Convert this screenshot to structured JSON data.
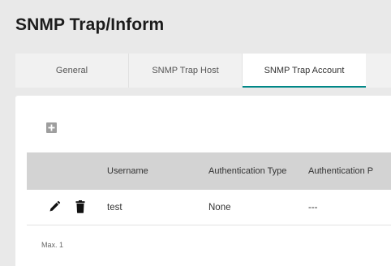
{
  "page": {
    "title": "SNMP Trap/Inform"
  },
  "tabs": [
    {
      "label": "General",
      "active": false
    },
    {
      "label": "SNMP Trap Host",
      "active": false
    },
    {
      "label": "SNMP Trap Account",
      "active": true
    }
  ],
  "toolbar": {
    "add_icon": "plus-icon"
  },
  "table": {
    "columns": [
      "",
      "Username",
      "Authentication Type",
      "Authentication P"
    ],
    "rows": [
      {
        "actions": [
          "pencil-icon",
          "trash-icon"
        ],
        "username": "test",
        "auth_type": "None",
        "auth_protocol": "---"
      }
    ]
  },
  "footer": {
    "max_note": "Max. 1"
  },
  "colors": {
    "accent": "#008787",
    "header_bg": "#d3d3d3",
    "page_bg": "#e9e9e9"
  }
}
